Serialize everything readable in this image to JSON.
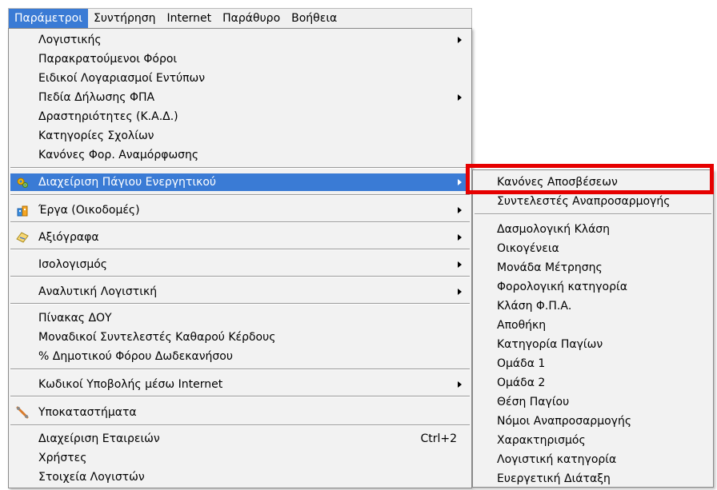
{
  "menubar": {
    "items": [
      "Παράμετροι",
      "Συντήρηση",
      "Internet",
      "Παράθυρο",
      "Βοήθεια"
    ]
  },
  "main_menu": {
    "items": [
      {
        "label": "Λογιστικής",
        "submenu": true
      },
      {
        "label": "Παρακρατούμενοι Φόροι"
      },
      {
        "label": "Ειδικοί Λογαριασμοί Εντύπων"
      },
      {
        "label": "Πεδία Δήλωσης ΦΠΑ",
        "submenu": true
      },
      {
        "label": "Δραστηριότητες (Κ.Α.Δ.)"
      },
      {
        "label": "Κατηγορίες Σχολίων"
      },
      {
        "label": "Κανόνες Φορ. Αναμόρφωσης"
      },
      {
        "label": "Διαχείριση Πάγιου Ενεργητικού",
        "submenu": true,
        "icon": "gears-icon"
      },
      {
        "label": "Έργα (Οικοδομές)",
        "submenu": true,
        "icon": "building-icon"
      },
      {
        "label": "Αξιόγραφα",
        "submenu": true,
        "icon": "document-icon"
      },
      {
        "label": "Ισολογισμός",
        "submenu": true
      },
      {
        "label": "Αναλυτική Λογιστική",
        "submenu": true
      },
      {
        "label": "Πίνακας ΔΟΥ"
      },
      {
        "label": "Μοναδικοί Συντελεστές Καθαρού Κέρδους"
      },
      {
        "label": "% Δημοτικού Φόρου Δωδεκανήσου"
      },
      {
        "label": "Κωδικοί Υποβολής μέσω Internet",
        "submenu": true
      },
      {
        "label": "Υποκαταστήματα",
        "icon": "branch-icon"
      },
      {
        "label": "Διαχείριση Εταιρειών",
        "shortcut": "Ctrl+2"
      },
      {
        "label": "Χρήστες"
      },
      {
        "label": "Στοιχεία Λογιστών"
      }
    ]
  },
  "sub_menu": {
    "items": [
      "Κανόνες Αποσβέσεων",
      "Συντελεστές Αναπροσαρμογής",
      "Δασμολογική Κλάση",
      "Οικογένεια",
      "Μονάδα Μέτρησης",
      "Φορολογική κατηγορία",
      "Κλάση Φ.Π.Α.",
      "Αποθήκη",
      "Κατηγορία Παγίων",
      "Ομάδα 1",
      "Ομάδα 2",
      "Θέση Παγίου",
      "Νόμοι Αναπροσαρμογής",
      "Χαρακτηρισμός",
      "Λογιστική κατηγορία",
      "Ευεργετική Διάταξη"
    ]
  },
  "colors": {
    "highlight": "#3a7bd5",
    "annotation": "#e60000",
    "menu_background": "#f2f2f2"
  }
}
